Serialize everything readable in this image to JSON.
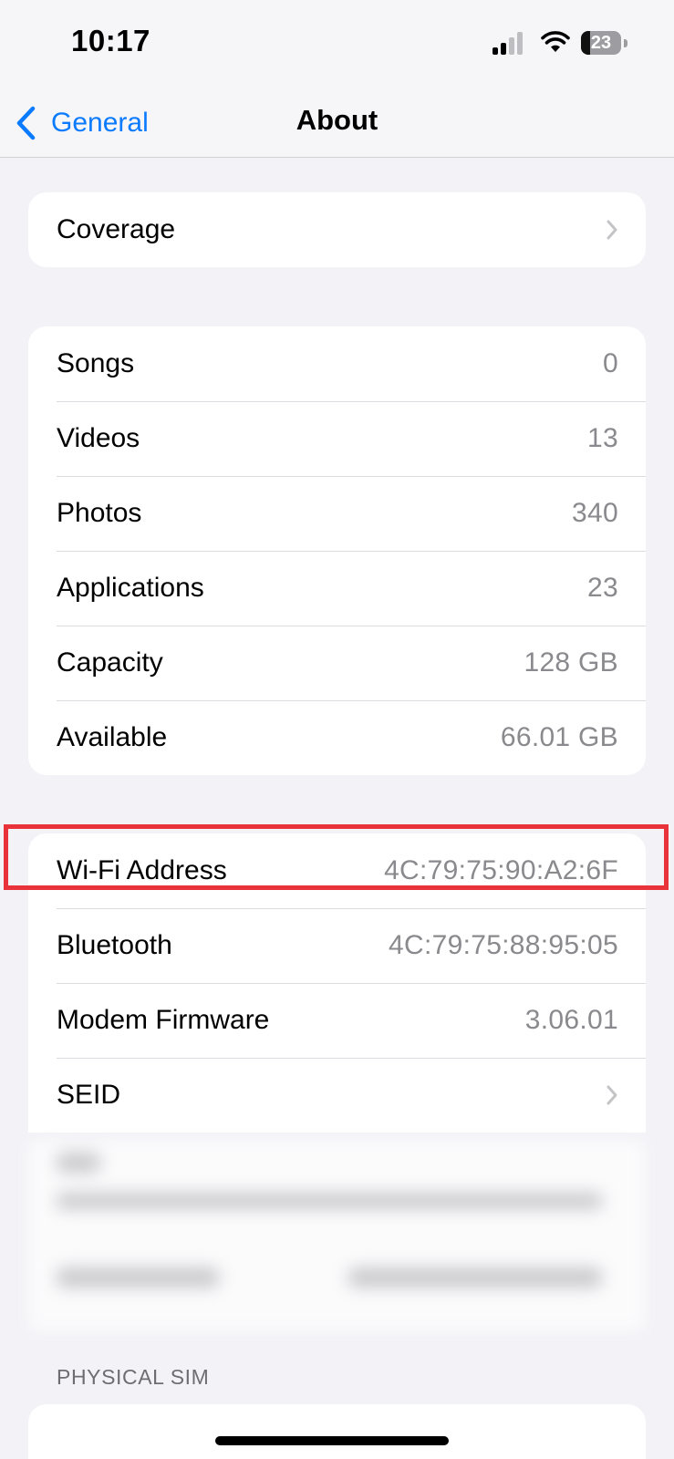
{
  "status_bar": {
    "time": "10:17",
    "battery_level": "23",
    "battery_fraction": 0.23
  },
  "nav": {
    "back_label": "General",
    "title": "About"
  },
  "coverage_group": {
    "label": "Coverage"
  },
  "media_group": {
    "rows": [
      {
        "label": "Songs",
        "value": "0"
      },
      {
        "label": "Videos",
        "value": "13"
      },
      {
        "label": "Photos",
        "value": "340"
      },
      {
        "label": "Applications",
        "value": "23"
      },
      {
        "label": "Capacity",
        "value": "128 GB"
      },
      {
        "label": "Available",
        "value": "66.01 GB"
      }
    ]
  },
  "network_group": {
    "wifi": {
      "label": "Wi-Fi Address",
      "value": "4C:79:75:90:A2:6F"
    },
    "bluetooth": {
      "label": "Bluetooth",
      "value": "4C:79:75:88:95:05"
    },
    "modem": {
      "label": "Modem Firmware",
      "value": "3.06.01"
    },
    "seid": {
      "label": "SEID"
    }
  },
  "physical_sim": {
    "header": "PHYSICAL SIM"
  },
  "colors": {
    "accent": "#0a7aff",
    "highlight": "#e8333a",
    "background": "#f2f2f7",
    "secondary_text": "#8a8a8e"
  },
  "icons": {
    "back": "chevron-left-icon",
    "disclosure": "chevron-right-icon",
    "signal": "cellular-signal-icon",
    "wifi": "wifi-icon",
    "battery": "battery-icon"
  }
}
